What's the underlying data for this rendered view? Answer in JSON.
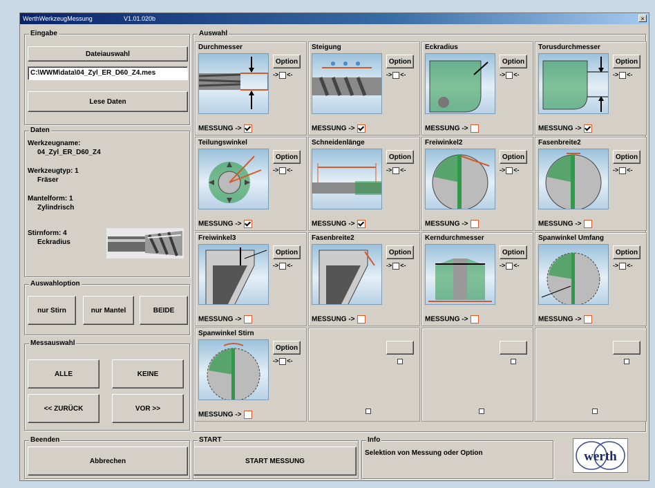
{
  "window": {
    "title": "WerthWerkzeugMessung",
    "version": "V1.01.020b",
    "close_label": "×"
  },
  "eingabe": {
    "group_label": "Eingabe",
    "file_button": "Dateiauswahl",
    "path_value": "C:\\WWM\\data\\04_Zyl_ER_D60_Z4.mes",
    "read_button": "Lese Daten"
  },
  "daten": {
    "group_label": "Daten",
    "werkzeugname_label": "Werkzeugname:",
    "werkzeugname_value": "04_Zyl_ER_D60_Z4",
    "werkzeugtyp_label": "Werkzeugtyp: 1",
    "werkzeugtyp_value": "Fräser",
    "mantelform_label": "Mantelform: 1",
    "mantelform_value": "Zylindrisch",
    "stirnform_label": "Stirnform: 4",
    "stirnform_value": "Eckradius"
  },
  "auswahloption": {
    "group_label": "Auswahloption",
    "buttons": [
      "nur Stirn",
      "nur Mantel",
      "BEIDE"
    ]
  },
  "messauswahl": {
    "group_label": "Messauswahl",
    "alle": "ALLE",
    "keine": "KEINE",
    "zurueck": "<< ZURÜCK",
    "vor": "VOR >>"
  },
  "auswahl": {
    "group_label": "Auswahl",
    "option_label": "Option",
    "option_arrow_left": "->",
    "option_arrow_right": "<-",
    "messung_label": "MESSUNG ->",
    "cells": [
      {
        "title": "Durchmesser",
        "checked": true
      },
      {
        "title": "Steigung",
        "checked": true
      },
      {
        "title": "Eckradius",
        "checked": false
      },
      {
        "title": "Torusdurchmesser",
        "checked": true
      },
      {
        "title": "Teilungswinkel",
        "checked": true
      },
      {
        "title": "Schneidenlänge",
        "checked": true
      },
      {
        "title": "Freiwinkel2",
        "checked": false
      },
      {
        "title": "Fasenbreite2",
        "checked": false
      },
      {
        "title": "Freiwinkel3",
        "checked": false
      },
      {
        "title": "Fasenbreite2",
        "checked": false
      },
      {
        "title": "Kerndurchmesser",
        "checked": false
      },
      {
        "title": "Spanwinkel Umfang",
        "checked": false
      },
      {
        "title": "Spanwinkel Stirn",
        "checked": false
      }
    ]
  },
  "beenden": {
    "group_label": "Beenden",
    "button": "Abbrechen"
  },
  "start": {
    "group_label": "START",
    "button": "START MESSUNG"
  },
  "info": {
    "group_label": "Info",
    "text": "Selektion von Messung oder Option"
  },
  "logo": {
    "text": "werth"
  },
  "colors": {
    "accent": "#d45a2a",
    "green": "#2e9a4a",
    "title_bar": "#0a246a"
  }
}
